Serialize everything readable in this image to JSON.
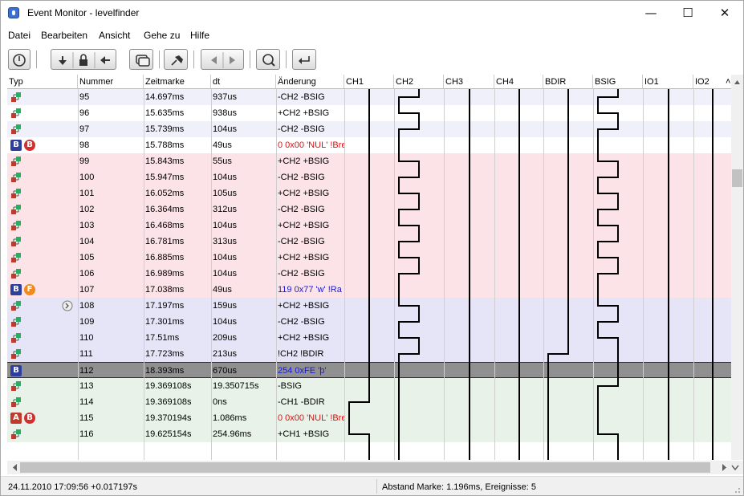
{
  "window": {
    "title": "Event Monitor - levelfinder",
    "minimize": "—",
    "maximize": "☐",
    "close": "✕"
  },
  "menu": [
    "Datei",
    "Bearbeiten",
    "Ansicht",
    "Gehe zu",
    "Hilfe"
  ],
  "toolbar": {
    "buttons": [
      "power-button",
      "marker-down-button",
      "lock-button",
      "marker-left-button",
      "windows-button",
      "pin-button",
      "prev-button",
      "next-button",
      "search-button",
      "enter-button"
    ]
  },
  "columns": [
    "Typ",
    "Nummer",
    "Zeitmarke",
    "dt",
    "Änderung",
    "CH1",
    "CH2",
    "CH3",
    "CH4",
    "BDIR",
    "BSIG",
    "IO1",
    "IO2"
  ],
  "colors": {
    "pink": "#fbe3e7",
    "lavender": "#e5e5f7",
    "green": "#e8f2e8",
    "selected": "#909090",
    "blue_text": "#1a1ad0",
    "red_text": "#e01010"
  },
  "rows": [
    {
      "icons": [
        "plug"
      ],
      "nr": "95",
      "ts": "14.697ms",
      "dt": "937us",
      "chg": "-CH2 -BSIG",
      "bg": "alt",
      "color": "black"
    },
    {
      "icons": [
        "plug"
      ],
      "nr": "96",
      "ts": "15.635ms",
      "dt": "938us",
      "chg": "+CH2 +BSIG",
      "bg": "white",
      "color": "black"
    },
    {
      "icons": [
        "plug"
      ],
      "nr": "97",
      "ts": "15.739ms",
      "dt": "104us",
      "chg": "-CH2 -BSIG",
      "bg": "alt",
      "color": "black"
    },
    {
      "icons": [
        "B-sq",
        "B-rnd-red"
      ],
      "nr": "98",
      "ts": "15.788ms",
      "dt": "49us",
      "chg": "0 0x00 'NUL' !Bre",
      "bg": "white",
      "color": "red"
    },
    {
      "icons": [
        "plug"
      ],
      "nr": "99",
      "ts": "15.843ms",
      "dt": "55us",
      "chg": "+CH2 +BSIG",
      "bg": "pink",
      "color": "black"
    },
    {
      "icons": [
        "plug"
      ],
      "nr": "100",
      "ts": "15.947ms",
      "dt": "104us",
      "chg": "-CH2 -BSIG",
      "bg": "pink",
      "color": "black"
    },
    {
      "icons": [
        "plug"
      ],
      "nr": "101",
      "ts": "16.052ms",
      "dt": "105us",
      "chg": "+CH2 +BSIG",
      "bg": "pink",
      "color": "black"
    },
    {
      "icons": [
        "plug"
      ],
      "nr": "102",
      "ts": "16.364ms",
      "dt": "312us",
      "chg": "-CH2 -BSIG",
      "bg": "pink",
      "color": "black"
    },
    {
      "icons": [
        "plug"
      ],
      "nr": "103",
      "ts": "16.468ms",
      "dt": "104us",
      "chg": "+CH2 +BSIG",
      "bg": "pink",
      "color": "black"
    },
    {
      "icons": [
        "plug"
      ],
      "nr": "104",
      "ts": "16.781ms",
      "dt": "313us",
      "chg": "-CH2 -BSIG",
      "bg": "pink",
      "color": "black"
    },
    {
      "icons": [
        "plug"
      ],
      "nr": "105",
      "ts": "16.885ms",
      "dt": "104us",
      "chg": "+CH2 +BSIG",
      "bg": "pink",
      "color": "black"
    },
    {
      "icons": [
        "plug"
      ],
      "nr": "106",
      "ts": "16.989ms",
      "dt": "104us",
      "chg": "-CH2 -BSIG",
      "bg": "pink",
      "color": "black"
    },
    {
      "icons": [
        "B-sq",
        "F-rnd-orange"
      ],
      "nr": "107",
      "ts": "17.038ms",
      "dt": "49us",
      "chg": "119 0x77 'w' !Ra",
      "bg": "pink",
      "color": "blue"
    },
    {
      "icons": [
        "plug",
        "circle-arrow"
      ],
      "nr": "108",
      "ts": "17.197ms",
      "dt": "159us",
      "chg": "+CH2 +BSIG",
      "bg": "lavender",
      "color": "black"
    },
    {
      "icons": [
        "plug"
      ],
      "nr": "109",
      "ts": "17.301ms",
      "dt": "104us",
      "chg": "-CH2 -BSIG",
      "bg": "lavender",
      "color": "black"
    },
    {
      "icons": [
        "plug"
      ],
      "nr": "110",
      "ts": "17.51ms",
      "dt": "209us",
      "chg": "+CH2 +BSIG",
      "bg": "lavender",
      "color": "black"
    },
    {
      "icons": [
        "plug"
      ],
      "nr": "111",
      "ts": "17.723ms",
      "dt": "213us",
      "chg": "!CH2 !BDIR",
      "bg": "lavender",
      "color": "black"
    },
    {
      "icons": [
        "B-sq"
      ],
      "nr": "112",
      "ts": "18.393ms",
      "dt": "670us",
      "chg": "254 0xFE 'þ'",
      "bg": "selected",
      "color": "blue"
    },
    {
      "icons": [
        "plug"
      ],
      "nr": "113",
      "ts": "19.369108s",
      "dt": "19.350715s",
      "chg": "-BSIG",
      "bg": "green",
      "color": "black"
    },
    {
      "icons": [
        "plug"
      ],
      "nr": "114",
      "ts": "19.369108s",
      "dt": "0ns",
      "chg": "-CH1 -BDIR",
      "bg": "green",
      "color": "black"
    },
    {
      "icons": [
        "A-sq-red",
        "B-rnd-red"
      ],
      "nr": "115",
      "ts": "19.370194s",
      "dt": "1.086ms",
      "chg": "0 0x00 'NUL' !Bre",
      "bg": "green",
      "color": "red"
    },
    {
      "icons": [
        "plug"
      ],
      "nr": "116",
      "ts": "19.625154s",
      "dt": "254.96ms",
      "chg": "+CH1 +BSIG",
      "bg": "green",
      "color": "black"
    }
  ],
  "status": {
    "left": "24.11.2010 17:09:56 +0.017197s",
    "right": "Abstand Marke: 1.196ms, Ereignisse: 5"
  }
}
